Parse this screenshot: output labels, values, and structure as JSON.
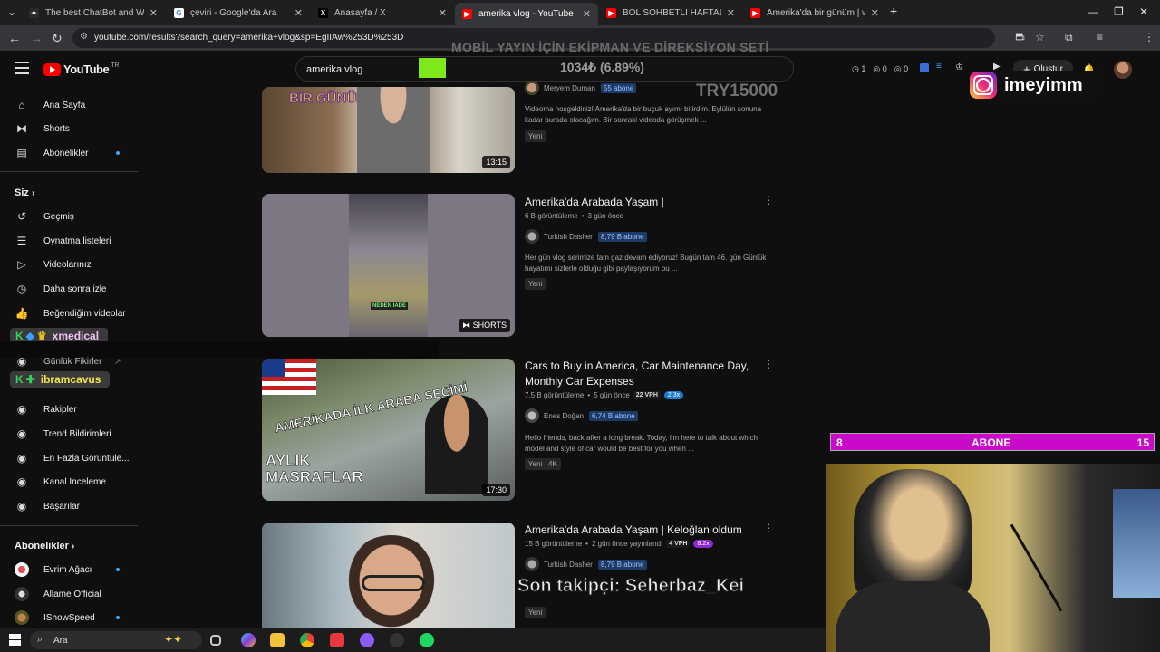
{
  "browser": {
    "tabs": [
      {
        "title": "The best ChatBot and Widgets f",
        "fav": "#2b2b2b",
        "glyph": "✦"
      },
      {
        "title": "çeviri - Google'da Ara",
        "fav": "#4285f4",
        "glyph": "G"
      },
      {
        "title": "Anasayfa / X",
        "fav": "#000000",
        "glyph": "𝕏"
      },
      {
        "title": "amerika vlog - YouTube",
        "fav": "#ff0000",
        "glyph": "▶"
      },
      {
        "title": "BOL SOHBETLİ HAFTALIK VLOG",
        "fav": "#ff0000",
        "glyph": "▶"
      },
      {
        "title": "Amerika'da bir günüm | work &",
        "fav": "#ff0000",
        "glyph": "▶"
      }
    ],
    "new_tab": "+",
    "url": "youtube.com/results?search_query=amerika+vlog&sp=EgIIAw%253D%253D"
  },
  "header": {
    "logo_text": "YouTube",
    "logo_country": "TR",
    "search_value": "amerika vlog",
    "counters": [
      "1",
      "0",
      "0"
    ],
    "create_label": "Oluştur"
  },
  "overlay": {
    "title": "MOBİL YAYIN İÇİN EKİPMAN VE DİREKSİYON SETİ",
    "amount": "1034₺ (6.89%)",
    "target": "TRY15000",
    "instagram_handle": "imeyimm",
    "abone_left": "8",
    "abone_label": "ABONE",
    "abone_right": "15",
    "last_follower": "Son takipçi: Seherbaz_Kei"
  },
  "sidebar": {
    "main": [
      {
        "label": "Ana Sayfa",
        "icon": "home-icon"
      },
      {
        "label": "Shorts",
        "icon": "shorts-icon"
      },
      {
        "label": "Abonelikler",
        "icon": "subscriptions-icon"
      }
    ],
    "you_heading": "Siz",
    "you": [
      {
        "label": "Geçmiş",
        "icon": "history-icon"
      },
      {
        "label": "Oynatma listeleri",
        "icon": "playlist-icon"
      },
      {
        "label": "Videolarınız",
        "icon": "your-videos-icon"
      },
      {
        "label": "Daha sonra izle",
        "icon": "watch-later-icon"
      },
      {
        "label": "Beğendiğim videolar",
        "icon": "like-icon"
      }
    ],
    "chat_badges": [
      "xmedical",
      "ibramcavus"
    ],
    "tools": [
      "Günlük Fikirler",
      "Rakipler",
      "Trend Bildirimleri",
      "En Fazla Görüntüle...",
      "Kanal Inceleme",
      "Başarılar"
    ],
    "subs_heading": "Abonelikler",
    "subs": [
      "Evrim Ağacı",
      "Allame Official",
      "IShowSpeed"
    ]
  },
  "results": [
    {
      "title": "",
      "channel": "Meryem Duman",
      "subs": "55 abone",
      "desc": "Videoma hoşgeldiniz! Amerika'da bir buçuk ayımı bitirdim. Eylülün sonuna kadar burada olacağım. Bir sonraki videoda görüşmek ...",
      "tags": [
        "Yeni"
      ],
      "duration": "13:15",
      "thumb_text": "BİR GÜNÜM"
    },
    {
      "title": "Amerika'da Arabada Yaşam |",
      "views": "6 B görüntüleme",
      "age": "3 gün önce",
      "channel": "Turkish Dasher",
      "subs": "8,79 B abone",
      "desc": "Her gün vlog serimize tam gaz devam ediyoruz! Bugün tam 46. gün Günlük hayatımı sizlerle olduğu gibi paylaşıyorum bu ...",
      "tags": [
        "Yeni"
      ],
      "duration": "SHORTS",
      "thumb_text": "NEDEN İADE"
    },
    {
      "title": "Cars to Buy in America, Car Maintenance Day, Monthly Car Expenses",
      "views": "7,5 B görüntüleme",
      "age": "5 gün önce",
      "vph": "22 VPH",
      "mult": "2.3x",
      "channel": "Enes Doğan",
      "subs": "6,74 B abone",
      "desc": "Hello friends, back after a long break. Today, I'm here to talk about which model and style of car would be best for you when ...",
      "tags": [
        "Yeni",
        "4K"
      ],
      "duration": "17:30",
      "thumb_text": "AMERİKADA İLK ARABA SEÇİMİ",
      "thumb_text2": "AYLIK MASRAFLAR"
    },
    {
      "title": "Amerika'da Arabada Yaşam | Keloğlan oldum",
      "views": "15 B görüntüleme",
      "age": "2 gün önce yayınlandı",
      "vph": "4 VPH",
      "mult": "8.2x",
      "channel": "Turkish Dasher",
      "subs": "8,79 B abone",
      "tags": [
        "Yeni"
      ]
    }
  ],
  "taskbar": {
    "search_placeholder": "Ara"
  }
}
